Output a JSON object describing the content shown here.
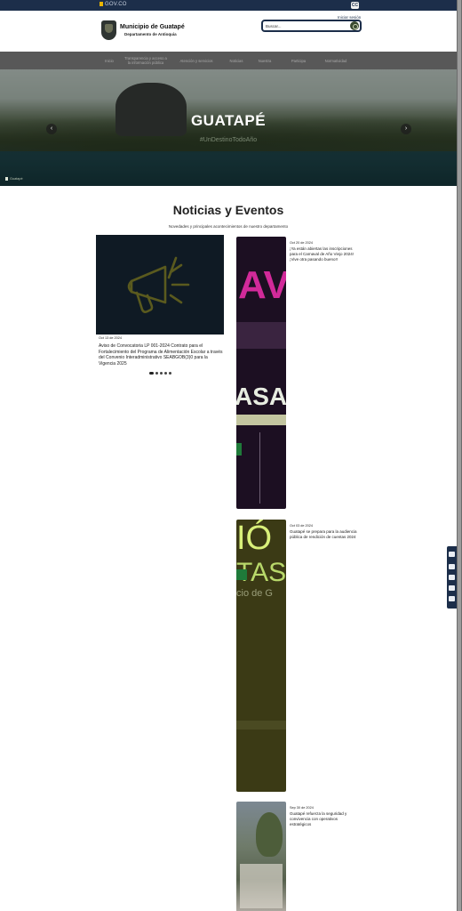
{
  "topbar": {
    "gov_label": "GOV.CO",
    "accessibility_label": "CC"
  },
  "header": {
    "brand_name": "Municipio de Guatapé",
    "brand_sub": "Departamento de Antioquia",
    "login_label": "Iniciar sesión",
    "search_value": "Buscar..."
  },
  "nav": {
    "items": [
      {
        "label": "Inicio"
      },
      {
        "label": "Transparencia y acceso a la información pública"
      },
      {
        "label": "Atención y servicios"
      },
      {
        "label": "Noticias"
      },
      {
        "label": "Nuestra"
      },
      {
        "label": "Participa"
      },
      {
        "label": "Normatividad"
      }
    ]
  },
  "hero": {
    "title": "GUATAPÉ",
    "subtitle": "#UnDestinoTodoAño",
    "caption": "Guatapé"
  },
  "news": {
    "title": "Noticias y Eventos",
    "subtitle": "Novedades y principales acontecimientos de nuestro departamento",
    "featured": {
      "date": "Oct 13 de 2024",
      "title": "Aviso de Convocatoria LP 001-2024 Contrato para el Fortalecimiento del Programa de Alimentación Escolar a través del Convenio Interadministrativo SEABGOB(3)0 para la Vigencia 2025",
      "icon": "megaphone-icon"
    },
    "items": [
      {
        "date": "Oct 20 de 2024",
        "title": "¡Ya están abiertas las inscripciones para el Carnaval de Año Viejo 2024! ¡Vive otra pasando bueno!!",
        "thumb_text_1": "AV",
        "thumb_text_2": "ASA"
      },
      {
        "date": "Oct 03 de 2024",
        "title": "Guatapé se prepara para la audiencia pública de rendición de cuentas 2024",
        "thumb_text_1": "IÓ",
        "thumb_text_2": "TAS",
        "thumb_text_3": "cio de G"
      },
      {
        "date": "Sep 30 de 2024",
        "title": "Guatapé refuerza la seguridad y convivencia con operativos estratégicos"
      }
    ]
  },
  "colors": {
    "brand_dark": "#1c2e4a",
    "nav_bg": "#585858",
    "accent_olive": "#3a4a2f"
  }
}
